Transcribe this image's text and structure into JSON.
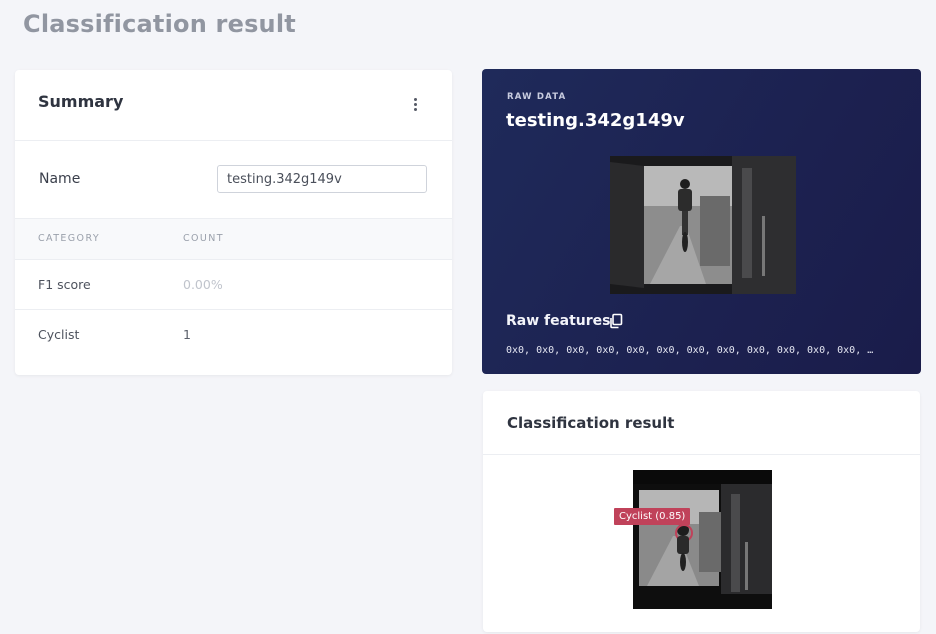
{
  "page": {
    "title": "Classification result"
  },
  "summary": {
    "title": "Summary",
    "name_label": "Name",
    "name_value": "testing.342g149v",
    "columns": {
      "category": "CATEGORY",
      "count": "COUNT"
    },
    "rows": [
      {
        "category": "F1 score",
        "count": "0.00%"
      },
      {
        "category": "Cyclist",
        "count": "1"
      }
    ]
  },
  "raw_data": {
    "kicker": "RAW DATA",
    "name": "testing.342g149v",
    "features_label": "Raw features",
    "features_values": "0x0, 0x0, 0x0, 0x0, 0x0, 0x0, 0x0, 0x0, 0x0, 0x0, 0x0, 0x0, …"
  },
  "result": {
    "title": "Classification result",
    "badge": "Cyclist (0.85)"
  },
  "icons": {
    "menu": "kebab-menu-icon",
    "copy": "copy-icon"
  },
  "colors": {
    "raw_card_bg": "#1e2656",
    "badge": "#c0425a"
  }
}
